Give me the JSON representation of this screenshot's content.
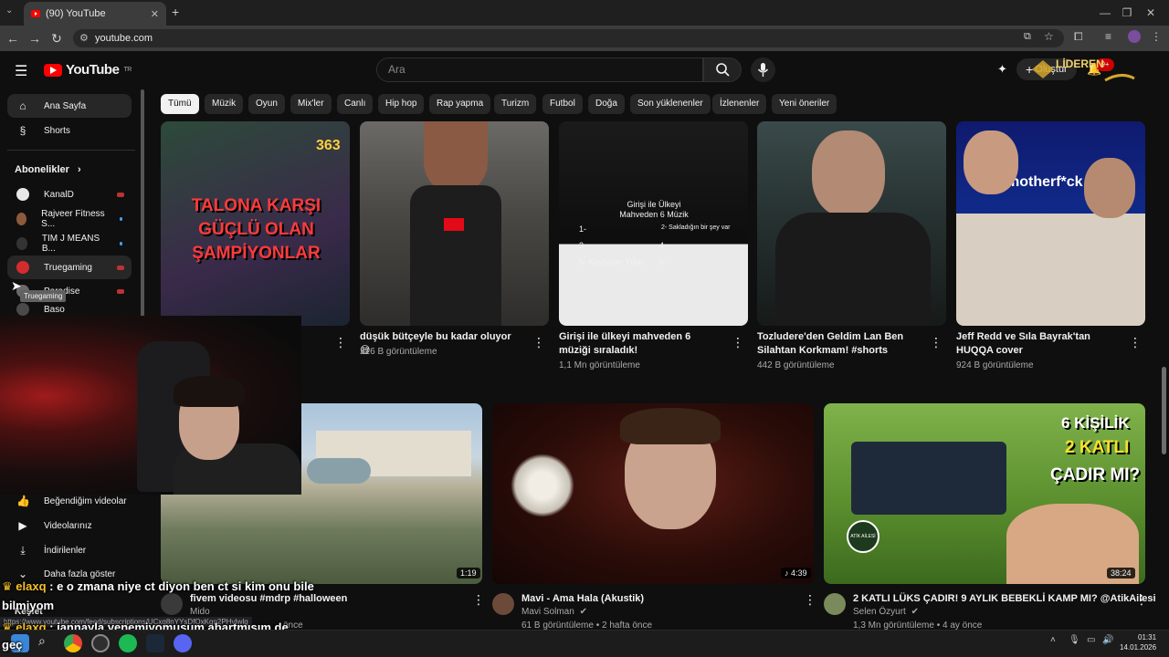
{
  "browser": {
    "tab_title": "(90) YouTube",
    "url": "youtube.com",
    "status_url": "https://www.youtube.com/feed/subscriptions/UCxq8nYYsDfOxKgn2PHvIwlg"
  },
  "youtube": {
    "logo_text": "YouTube",
    "logo_sup": "TR",
    "search_placeholder": "Ara",
    "create_label": "Oluştur",
    "notif_badge": "9+"
  },
  "sidebar": {
    "home": "Ana Sayfa",
    "shorts": "Shorts",
    "subs_title": "Abonelikler",
    "subs": [
      {
        "name": "KanalD",
        "avatar": "#e8e8e8"
      },
      {
        "name": "Rajveer Fitness S...",
        "avatar": "#8b5a3c"
      },
      {
        "name": "TIM J MEANS B...",
        "avatar": "#222222"
      },
      {
        "name": "Truegaming",
        "avatar": "#d42c2c"
      },
      {
        "name": "Paradise",
        "avatar": "#6a6a6a"
      },
      {
        "name": "Baso",
        "avatar": "#4a4a4a"
      }
    ],
    "tooltip": "Truegaming",
    "liked": "Beğendiğim videolar",
    "your_videos": "Videolarınız",
    "downloads": "İndirilenler",
    "show_more": "Daha fazla göster",
    "explore": "Keşfet"
  },
  "chips": [
    "Tümü",
    "Müzik",
    "Oyun",
    "Mix'ler",
    "Canlı",
    "Hip hop",
    "Rap yapma",
    "Turizm",
    "Futbol",
    "Doğa",
    "Son yüklenenler",
    "İzlenenler",
    "Yeni öneriler"
  ],
  "row1": [
    {
      "thumb_text": "TALONA KARŞI GÜÇLÜ OLAN ŞAMPİYONLAR",
      "thumb_num": "363",
      "title": "",
      "meta": ""
    },
    {
      "title": "düşük bütçeyle bu kadar oluyor 😅",
      "meta": "216 B görüntüleme"
    },
    {
      "title": "Girişi ile ülkeyi mahveden 6 müziği sıraladık!",
      "meta": "1,1 Mn görüntüleme",
      "thumb_heading": "Girişi ile Ülkeyi Mahveden 6 Müzik",
      "thumb_list": [
        "1-",
        "2- Sakladığın bir şey var",
        "3-",
        "4-",
        "5- Kaybolan Yıllar",
        "6-"
      ]
    },
    {
      "title": "Tozludere'den Geldim Lan Ben Silahtan Korkmam! #shorts",
      "meta": "442 B görüntüleme"
    },
    {
      "title": "Jeff Redd ve Sıla Bayrak'tan HUQQA cover",
      "meta": "924 B görüntüleme",
      "thumb_text": "motherf*ck"
    }
  ],
  "row2": [
    {
      "title": "fivem videosu #mdrp #halloween",
      "channel": "Mido",
      "meta": "önce",
      "duration": "1:19"
    },
    {
      "title": "Mavi - Ama Hala (Akustik)",
      "channel": "Mavi Solman",
      "meta": "61 B görüntüleme • 2 hafta önce",
      "duration": "4:39"
    },
    {
      "title": "2 KATLI LÜKS ÇADIR! 9 AYLIK BEBEKLİ KAMP MI? @AtikAilesi",
      "channel": "Selen Özyurt",
      "meta": "1,3 Mn görüntüleme • 4 ay önce",
      "duration": "38:24",
      "thumb_text_1": "6 KİŞİLİK",
      "thumb_text_2": "2 KATLI",
      "thumb_text_3": "ÇADIR MI?",
      "thumb_badge": "ATİK AİLESİ"
    }
  ],
  "chat": [
    {
      "user": "elaxq",
      "sep": " : ",
      "msg": "e o zmana niye ct diyon ben ct si kim onu bile"
    },
    {
      "cont": "bilmiyom"
    },
    {
      "user": "elaxq",
      "sep": " : ",
      "msg": "jannayla yenemiyomuşum abartmışım de"
    },
    {
      "cont": "geç"
    }
  ],
  "taskbar": {
    "time": "01:31",
    "date": "14.01.2026"
  },
  "overlay_logo": "LİDEREN"
}
